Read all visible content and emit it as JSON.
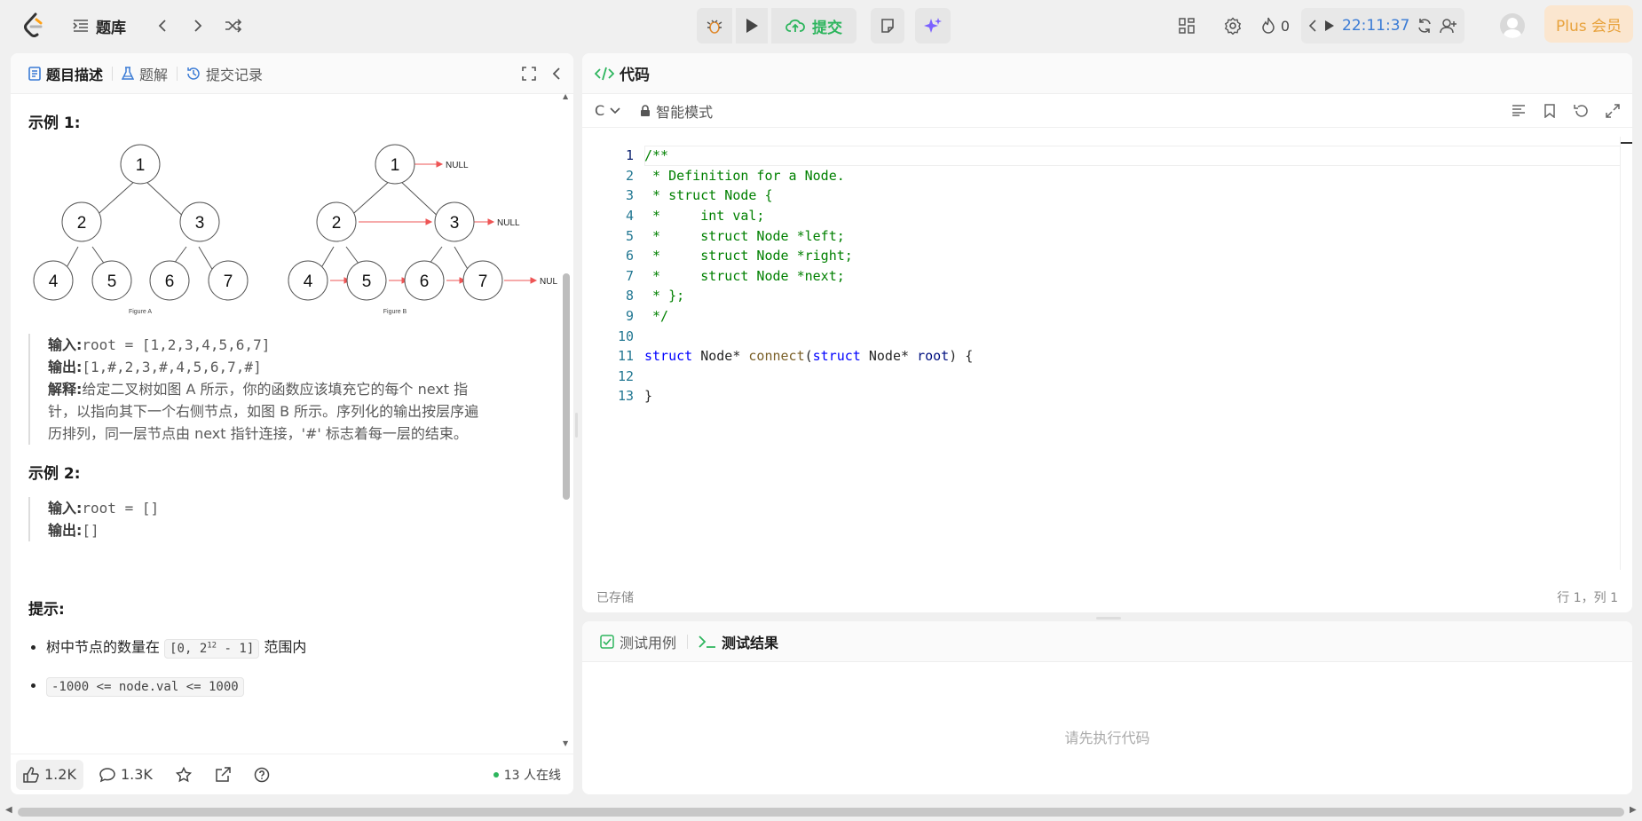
{
  "header": {
    "problemset_label": "题库",
    "submit_label": "提交",
    "streak_count": "0",
    "timer": "22:11:37",
    "plus_label": "Plus 会员"
  },
  "left_panel": {
    "tabs": [
      {
        "label": "题目描述",
        "icon": "document-icon"
      },
      {
        "label": "题解",
        "icon": "flask-icon"
      },
      {
        "label": "提交记录",
        "icon": "history-icon"
      }
    ],
    "example1_title": "示例 1:",
    "figure_a_caption": "Figure A",
    "figure_b_caption": "Figure B",
    "null_label": "NULL",
    "tree_nodes": [
      "1",
      "2",
      "3",
      "4",
      "5",
      "6",
      "7"
    ],
    "example1": {
      "input_label": "输入:",
      "input_value": "root = [1,2,3,4,5,6,7]",
      "output_label": "输出:",
      "output_value": "[1,#,2,3,#,4,5,6,7,#]",
      "explain_label": "解释:",
      "explain_line1": "给定二叉树如图 A 所示，你的函数应该填充它的每个 next 指",
      "explain_line2": "针，以指向其下一个右侧节点，如图 B 所示。序列化的输出按层序遍",
      "explain_line3": "历排列，同一层节点由 next 指针连接，'#' 标志着每一层的结束。"
    },
    "example2_title": "示例 2:",
    "example2": {
      "input_label": "输入:",
      "input_value": "root = []",
      "output_label": "输出:",
      "output_value": "[]"
    },
    "hints_title": "提示:",
    "hint1_pre": "树中节点的数量在",
    "hint1_code_a": "[0, 2",
    "hint1_code_sup": "12",
    "hint1_code_b": " - 1]",
    "hint1_post": "范围内",
    "hint2_code": "-1000 <= node.val <= 1000",
    "likes": "1.2K",
    "comments": "1.3K",
    "online": "13 人在线"
  },
  "code_panel": {
    "title": "代码",
    "language": "C",
    "mode_label": "智能模式",
    "line_numbers": [
      "1",
      "2",
      "3",
      "4",
      "5",
      "6",
      "7",
      "8",
      "9",
      "10",
      "11",
      "12",
      "13"
    ],
    "lines": {
      "l1": "/**",
      "l2": " * Definition for a Node.",
      "l3": " * struct Node {",
      "l4": " *     int val;",
      "l5": " *     struct Node *left;",
      "l6": " *     struct Node *right;",
      "l7": " *     struct Node *next;",
      "l8": " * };",
      "l9": " */",
      "l10": "",
      "l11_kw1": "struct",
      "l11_type": " Node* ",
      "l11_fn": "connect",
      "l11_p1": "(",
      "l11_kw2": "struct",
      "l11_type2": " Node* ",
      "l11_var": "root",
      "l11_end": ") {",
      "l12": "",
      "l13": "}"
    },
    "saved_label": "已存储",
    "cursor_pos": "行 1，列 1"
  },
  "result_panel": {
    "testcase_label": "测试用例",
    "result_label": "测试结果",
    "empty_text": "请先执行代码"
  },
  "colors": {
    "accent_green": "#2db55d",
    "timer_blue": "#3a7bd5",
    "plus_bg": "#fbe6cf",
    "plus_text": "#e8a23c"
  }
}
